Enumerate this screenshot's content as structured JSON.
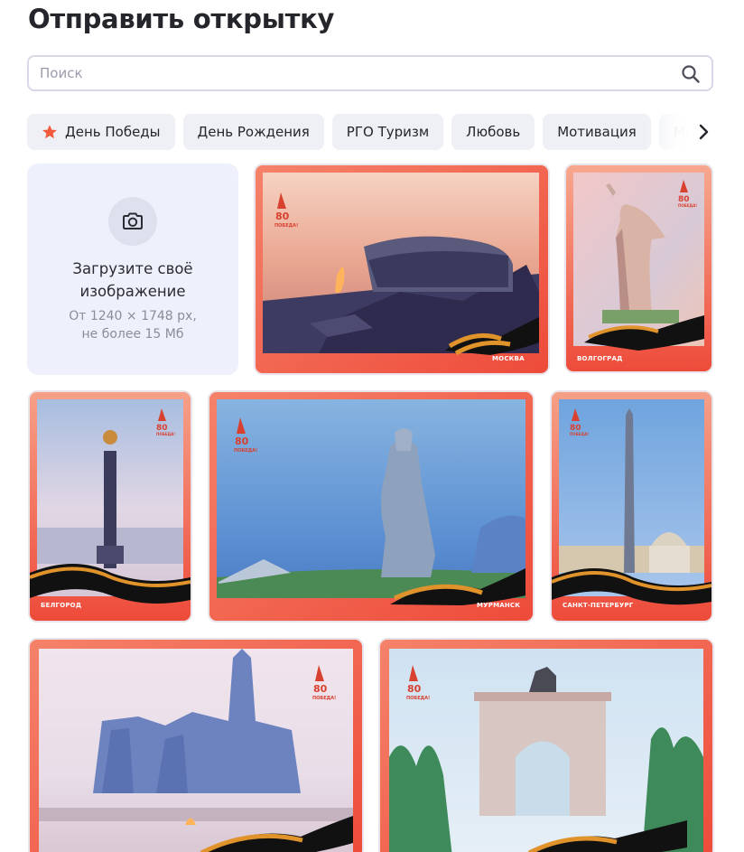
{
  "page": {
    "title": "Отправить открытку"
  },
  "search": {
    "placeholder": "Поиск",
    "value": ""
  },
  "categories": [
    {
      "label": "День Победы",
      "icon": "star-icon",
      "selected": true
    },
    {
      "label": "День Рождения"
    },
    {
      "label": "РГО Туризм"
    },
    {
      "label": "Любовь"
    },
    {
      "label": "Мотивация"
    },
    {
      "label": "Ми"
    }
  ],
  "upload": {
    "title": "Загрузите своё изображение",
    "hint_line1": "От 1240 × 1748 px,",
    "hint_line2": "не более 15 Мб"
  },
  "postcards": [
    {
      "city": "МОСКВА",
      "badge": "80 ПОБЕДА!"
    },
    {
      "city": "ВОЛГОГРАД",
      "badge": "80 ПОБЕДА!"
    },
    {
      "city": "БЕЛГОРОД",
      "badge": "80 ПОБЕДА!"
    },
    {
      "city": "МУРМАНСК",
      "badge": "80 ПОБЕДА!"
    },
    {
      "city": "САНКТ-ПЕТЕРБУРГ",
      "badge": "80 ПОБЕДА!"
    },
    {
      "city": "",
      "badge": "80 ПОБЕДА!"
    },
    {
      "city": "",
      "badge": "80 ПОБЕДА!"
    }
  ],
  "colors": {
    "accent": "#f15a3b",
    "chip_bg": "#eef0f5",
    "upload_bg": "#eef1fb",
    "card_frame": "#f26a4a"
  }
}
